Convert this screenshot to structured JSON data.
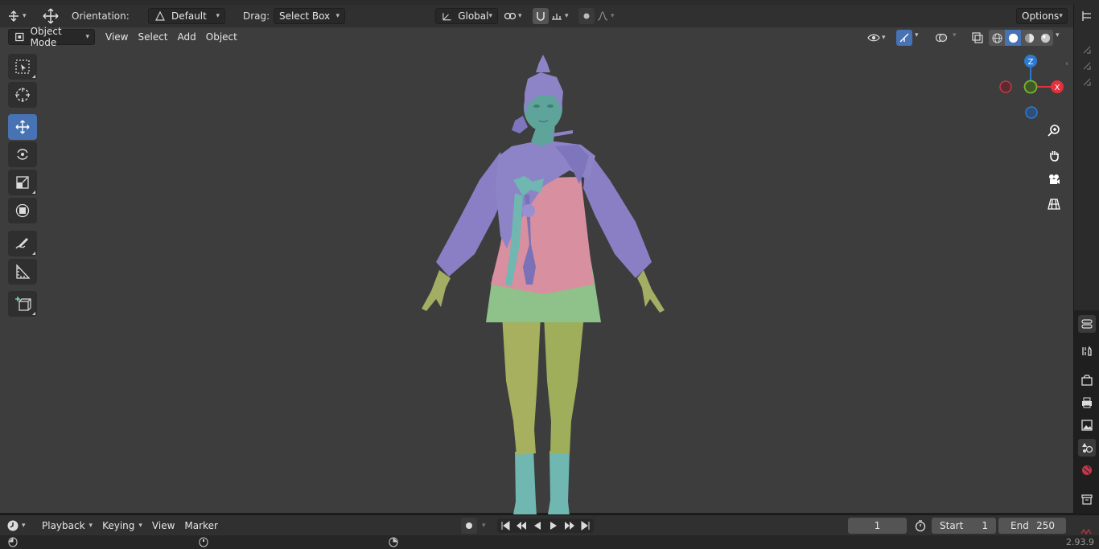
{
  "tool_header": {
    "orientation_label": "Orientation:",
    "orientation_value": "Default",
    "drag_label": "Drag:",
    "drag_value": "Select Box",
    "transform_pivot": "Global",
    "options_label": "Options"
  },
  "view_header": {
    "mode": "Object Mode",
    "menus": [
      "View",
      "Select",
      "Add",
      "Object"
    ]
  },
  "gizmo": {
    "z_label": "Z",
    "x_label": "X",
    "colors": {
      "x": "#e3313d",
      "y": "#7bb234",
      "z": "#2d7ad3"
    }
  },
  "timeline": {
    "menus": [
      "Playback",
      "Keying",
      "View",
      "Marker"
    ],
    "current_frame": "1",
    "start_label": "Start",
    "start_value": "1",
    "end_label": "End",
    "end_value": "250"
  },
  "status": {
    "version": "2.93.9"
  },
  "colors": {
    "accent": "#4772b3",
    "viewport_bg": "#3d3d3d"
  }
}
